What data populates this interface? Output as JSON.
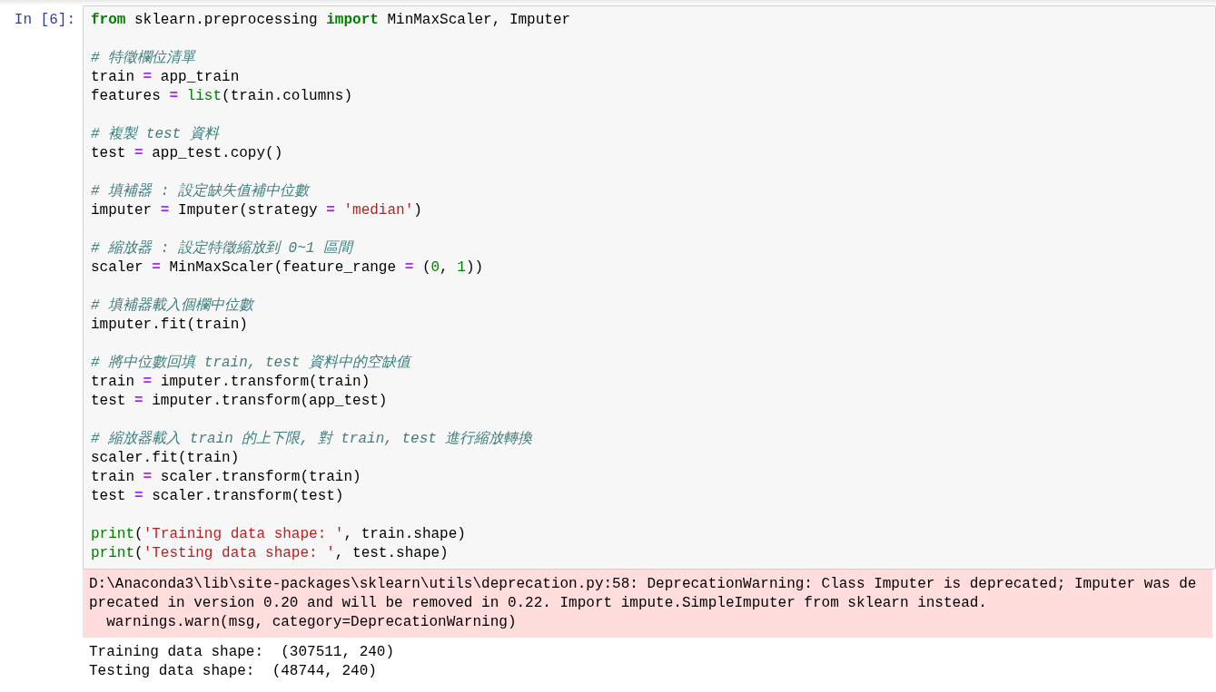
{
  "cell": {
    "prompt": "In [6]:",
    "code_blocks": [
      [
        [
          {
            "kind": "kw",
            "text": "from"
          },
          {
            "kind": "plain",
            "text": " sklearn.preprocessing "
          },
          {
            "kind": "kw",
            "text": "import"
          },
          {
            "kind": "plain",
            "text": " MinMaxScaler, Imputer"
          }
        ]
      ],
      [
        [
          {
            "kind": "comment",
            "text": "# 特徵欄位清單"
          }
        ],
        [
          {
            "kind": "plain",
            "text": "train "
          },
          {
            "kind": "op",
            "text": "="
          },
          {
            "kind": "plain",
            "text": " app_train"
          }
        ],
        [
          {
            "kind": "plain",
            "text": "features "
          },
          {
            "kind": "op",
            "text": "="
          },
          {
            "kind": "builtin",
            "text": " list"
          },
          {
            "kind": "plain",
            "text": "(train.columns)"
          }
        ]
      ],
      [
        [
          {
            "kind": "comment",
            "text": "# 複製 test 資料"
          }
        ],
        [
          {
            "kind": "plain",
            "text": "test "
          },
          {
            "kind": "op",
            "text": "="
          },
          {
            "kind": "plain",
            "text": " app_test.copy()"
          }
        ]
      ],
      [
        [
          {
            "kind": "comment",
            "text": "# 填補器 : 設定缺失值補中位數"
          }
        ],
        [
          {
            "kind": "plain",
            "text": "imputer "
          },
          {
            "kind": "op",
            "text": "="
          },
          {
            "kind": "plain",
            "text": " Imputer(strategy "
          },
          {
            "kind": "op",
            "text": "="
          },
          {
            "kind": "str",
            "text": " 'median'"
          },
          {
            "kind": "plain",
            "text": ")"
          }
        ]
      ],
      [
        [
          {
            "kind": "comment",
            "text": "# 縮放器 : 設定特徵縮放到 0~1 區間"
          }
        ],
        [
          {
            "kind": "plain",
            "text": "scaler "
          },
          {
            "kind": "op",
            "text": "="
          },
          {
            "kind": "plain",
            "text": " MinMaxScaler(feature_range "
          },
          {
            "kind": "op",
            "text": "="
          },
          {
            "kind": "plain",
            "text": " ("
          },
          {
            "kind": "num",
            "text": "0"
          },
          {
            "kind": "plain",
            "text": ", "
          },
          {
            "kind": "num",
            "text": "1"
          },
          {
            "kind": "plain",
            "text": "))"
          }
        ]
      ],
      [
        [
          {
            "kind": "comment",
            "text": "# 填補器載入個欄中位數"
          }
        ],
        [
          {
            "kind": "plain",
            "text": "imputer.fit(train)"
          }
        ]
      ],
      [
        [
          {
            "kind": "comment",
            "text": "# 將中位數回填 train, test 資料中的空缺值"
          }
        ],
        [
          {
            "kind": "plain",
            "text": "train "
          },
          {
            "kind": "op",
            "text": "="
          },
          {
            "kind": "plain",
            "text": " imputer.transform(train)"
          }
        ],
        [
          {
            "kind": "plain",
            "text": "test "
          },
          {
            "kind": "op",
            "text": "="
          },
          {
            "kind": "plain",
            "text": " imputer.transform(app_test)"
          }
        ]
      ],
      [
        [
          {
            "kind": "comment",
            "text": "# 縮放器載入 train 的上下限, 對 train, test 進行縮放轉換"
          }
        ],
        [
          {
            "kind": "plain",
            "text": "scaler.fit(train)"
          }
        ],
        [
          {
            "kind": "plain",
            "text": "train "
          },
          {
            "kind": "op",
            "text": "="
          },
          {
            "kind": "plain",
            "text": " scaler.transform(train)"
          }
        ],
        [
          {
            "kind": "plain",
            "text": "test "
          },
          {
            "kind": "op",
            "text": "="
          },
          {
            "kind": "plain",
            "text": " scaler.transform(test)"
          }
        ]
      ],
      [
        [
          {
            "kind": "builtin",
            "text": "print"
          },
          {
            "kind": "plain",
            "text": "("
          },
          {
            "kind": "str",
            "text": "'Training data shape: '"
          },
          {
            "kind": "plain",
            "text": ", train.shape)"
          }
        ],
        [
          {
            "kind": "builtin",
            "text": "print"
          },
          {
            "kind": "plain",
            "text": "("
          },
          {
            "kind": "str",
            "text": "'Testing data shape: '"
          },
          {
            "kind": "plain",
            "text": ", test.shape)"
          }
        ]
      ]
    ],
    "outputs": [
      {
        "kind": "stderr",
        "lines": [
          "D:\\Anaconda3\\lib\\site-packages\\sklearn\\utils\\deprecation.py:58: DeprecationWarning: Class Imputer is deprecated; Imputer was de",
          "precated in version 0.20 and will be removed in 0.22. Import impute.SimpleImputer from sklearn instead.",
          "  warnings.warn(msg, category=DeprecationWarning)"
        ]
      },
      {
        "kind": "stdout",
        "lines": [
          "Training data shape:  (307511, 240)",
          "Testing data shape:  (48744, 240)"
        ]
      }
    ]
  }
}
